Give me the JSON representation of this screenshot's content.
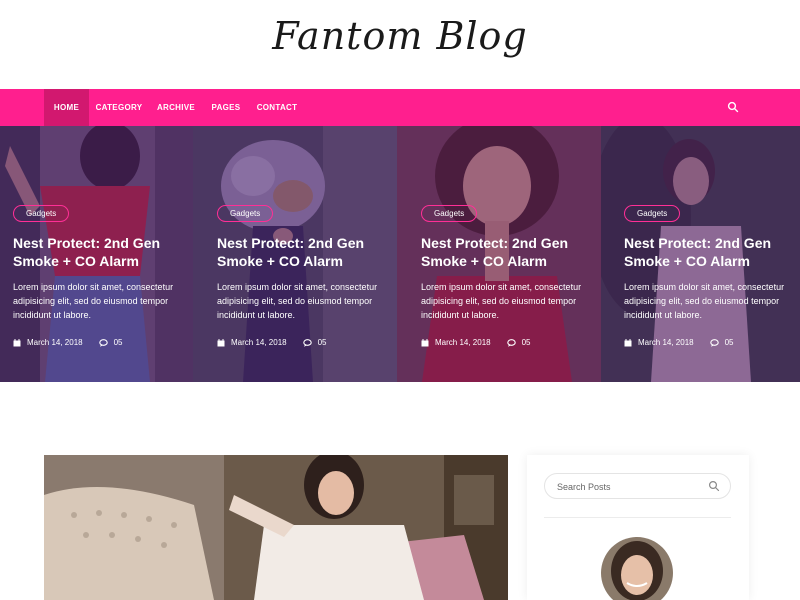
{
  "site": {
    "logo": "Fantom Blog"
  },
  "nav": {
    "items": [
      {
        "label": "HOME",
        "active": true
      },
      {
        "label": "CATEGORY",
        "active": false
      },
      {
        "label": "ARCHIVE",
        "active": false
      },
      {
        "label": "PAGES",
        "active": false
      },
      {
        "label": "CONTACT",
        "active": false
      }
    ],
    "search_icon": "search-icon"
  },
  "slider": {
    "posts": [
      {
        "category": "Gadgets",
        "title": "Nest Protect: 2nd Gen Smoke + CO Alarm",
        "excerpt": "Lorem ipsum dolor sit amet, consectetur adipisicing elit, sed do eiusmod tempor incididunt ut labore.",
        "date": "March 14, 2018",
        "comments": "05"
      },
      {
        "category": "Gadgets",
        "title": "Nest Protect: 2nd Gen Smoke + CO Alarm",
        "excerpt": "Lorem ipsum dolor sit amet, consectetur adipisicing elit, sed do eiusmod tempor incididunt ut labore.",
        "date": "March 14, 2018",
        "comments": "05"
      },
      {
        "category": "Gadgets",
        "title": "Nest Protect: 2nd Gen Smoke + CO Alarm",
        "excerpt": "Lorem ipsum dolor sit amet, consectetur adipisicing elit, sed do eiusmod tempor incididunt ut labore.",
        "date": "March 14, 2018",
        "comments": "05"
      },
      {
        "category": "Gadgets",
        "title": "Nest Protect: 2nd Gen Smoke + CO Alarm",
        "excerpt": "Lorem ipsum dolor sit amet, consectetur adipisicing elit, sed do eiusmod tempor incididunt ut labore.",
        "date": "March 14, 2018",
        "comments": "05"
      }
    ]
  },
  "sidebar": {
    "search": {
      "placeholder": "Search Posts"
    }
  },
  "colors": {
    "accent": "#ff1f8e",
    "accent_dark": "#d2186f",
    "overlay": "#481c6c"
  }
}
